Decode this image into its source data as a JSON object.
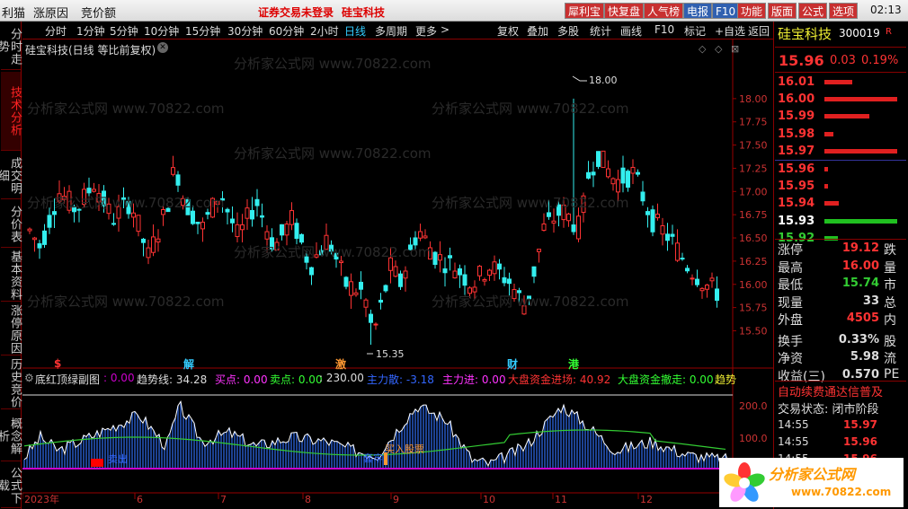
{
  "menubar": {
    "items": [
      "利猫",
      "涨原因",
      "竞价额"
    ],
    "notice": "证券交易未登录",
    "notice_stock": "硅宝科技",
    "buttons": [
      {
        "label": "犀利宝",
        "color": "#c83030"
      },
      {
        "label": "快复盘",
        "color": "#c83030"
      },
      {
        "label": "人气榜",
        "color": "#c83030"
      },
      {
        "label": "电报",
        "color": "#3060b0"
      },
      {
        "label": "F10",
        "color": "#3060b0"
      },
      {
        "label": "功能",
        "color": "#c83030"
      },
      {
        "label": "版面",
        "color": "#c83030"
      },
      {
        "label": "公式",
        "color": "#c83030"
      },
      {
        "label": "选项",
        "color": "#c83030"
      }
    ],
    "clock": "02:13"
  },
  "left_tabs": [
    "分时走势",
    "技术分析",
    "成交明细",
    "分价表",
    "基本资料",
    "涨停原因",
    "历史竞价",
    "概念解析",
    "公式下载"
  ],
  "period_bar": {
    "periods": [
      "分时",
      "1分钟",
      "5分钟",
      "10分钟",
      "15分钟",
      "30分钟",
      "60分钟",
      "2小时",
      "日线",
      "多周期",
      "更多"
    ],
    "active": "日线",
    "tools": [
      "复权",
      "叠加",
      "多股",
      "统计",
      "画线",
      "F10",
      "标记",
      "+自选",
      "返回"
    ]
  },
  "chart_title": "硅宝科技(日线 等比前复权)",
  "watermark": "分析家公式网 www.70822.com",
  "right_panel": {
    "name": "硅宝科技",
    "code": "300019",
    "badge": "R",
    "price": "15.96",
    "change": "0.03",
    "change_pct": "0.19%",
    "asks": [
      {
        "price": "16.01",
        "bar": 0.38
      },
      {
        "price": "16.00",
        "bar": 1.0
      },
      {
        "price": "15.99",
        "bar": 0.62
      },
      {
        "price": "15.98",
        "bar": 0.12
      },
      {
        "price": "15.97",
        "bar": 1.0
      }
    ],
    "bids": [
      {
        "price": "15.96",
        "bar": 0.05
      },
      {
        "price": "15.95",
        "bar": 0.05
      },
      {
        "price": "15.94",
        "bar": 0.2
      },
      {
        "price": "15.93",
        "bar": 1.0
      },
      {
        "price": "15.92",
        "bar": 0.18
      }
    ],
    "stats": [
      {
        "label": "涨停",
        "value": "19.12",
        "tail": "跌",
        "color": "#f33"
      },
      {
        "label": "最高",
        "value": "16.00",
        "tail": "量",
        "color": "#f33"
      },
      {
        "label": "最低",
        "value": "15.74",
        "tail": "市",
        "color": "#3c3"
      },
      {
        "label": "现量",
        "value": "33",
        "tail": "总",
        "color": "#ddd"
      },
      {
        "label": "外盘",
        "value": "4505",
        "tail": "内",
        "color": "#f33"
      },
      {
        "label": "换手",
        "value": "0.33%",
        "tail": "股",
        "color": "#ddd"
      },
      {
        "label": "净资",
        "value": "5.98",
        "tail": "流",
        "color": "#ddd"
      },
      {
        "label": "收益(三)",
        "value": "0.570",
        "tail": "PE",
        "color": "#ddd"
      }
    ],
    "auto_note": "自动续费通达信普及",
    "trade_state": "交易状态: 闭市阶段",
    "ticks": [
      {
        "time": "14:55",
        "price": "15.97"
      },
      {
        "time": "14:55",
        "price": "15.96"
      },
      {
        "time": "14:55",
        "price": "15.96"
      }
    ]
  },
  "logo": {
    "text": "分析家公式网",
    "url": "www.70822.com"
  },
  "indicator": {
    "name": "底红顶绿副图",
    "items": [
      {
        "label": ": 0.00",
        "color": "#c0c"
      },
      {
        "label": "趋势线: 34.28",
        "color": "#ddd"
      },
      {
        "label": "买点: 0.00",
        "color": "#f3f"
      },
      {
        "label": "卖点: 0.00",
        "color": "#3f3"
      },
      {
        "label": ": 230.00",
        "color": "#ddd"
      },
      {
        "label": "主力散: -3.18",
        "color": "#36f"
      },
      {
        "label": "主力进: 0.00",
        "color": "#f3f"
      },
      {
        "label": "大盘资金进场: 40.92",
        "color": "#f33"
      },
      {
        "label": "大盘资金撤走: 0.00",
        "color": "#3f3"
      },
      {
        "label": "趋势",
        "color": "#ee3"
      }
    ],
    "ytick": "200.0",
    "ytick2": "100.0"
  },
  "annotations": [
    {
      "label": "$",
      "color": "#f33"
    },
    {
      "label": "解",
      "color": "#3cf"
    },
    {
      "label": "激",
      "color": "#f93"
    },
    {
      "label": "财",
      "color": "#3cf"
    },
    {
      "label": "港",
      "color": "#3f3"
    }
  ],
  "lower_labels": {
    "sell": "卖出",
    "buy": "买入股票",
    "buy2": "套牢"
  },
  "chart_data": {
    "type": "candlestick",
    "y_ticks": [
      "18.00",
      "17.75",
      "17.50",
      "17.25",
      "17.00",
      "16.75",
      "16.50",
      "16.25",
      "16.00",
      "15.75",
      "15.50"
    ],
    "ylim": [
      15.35,
      18.25
    ],
    "high_label": "18.00",
    "low_label": "15.35",
    "x_labels": [
      "2023年",
      "6",
      "7",
      "8",
      "9",
      "10",
      "11",
      "12"
    ]
  }
}
